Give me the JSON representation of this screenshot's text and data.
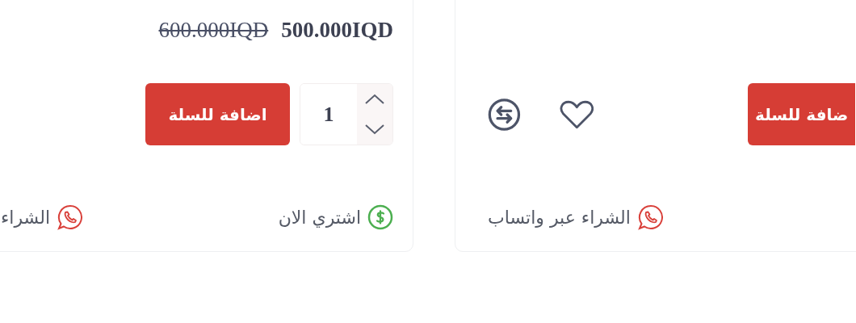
{
  "cards": [
    {
      "add_to_cart": "ضافة للسلة",
      "actions": [
        {
          "kind": "wishlist"
        },
        {
          "kind": "compare"
        }
      ],
      "whatsapp": "الشراء عبر واتساب"
    },
    {
      "old_price": "600.000IQD",
      "price": "500.000IQD",
      "quantity": "1",
      "add_to_cart": "اضافة للسلة",
      "buy_now": "اشتري الان",
      "whatsapp": "الشراء"
    }
  ]
}
